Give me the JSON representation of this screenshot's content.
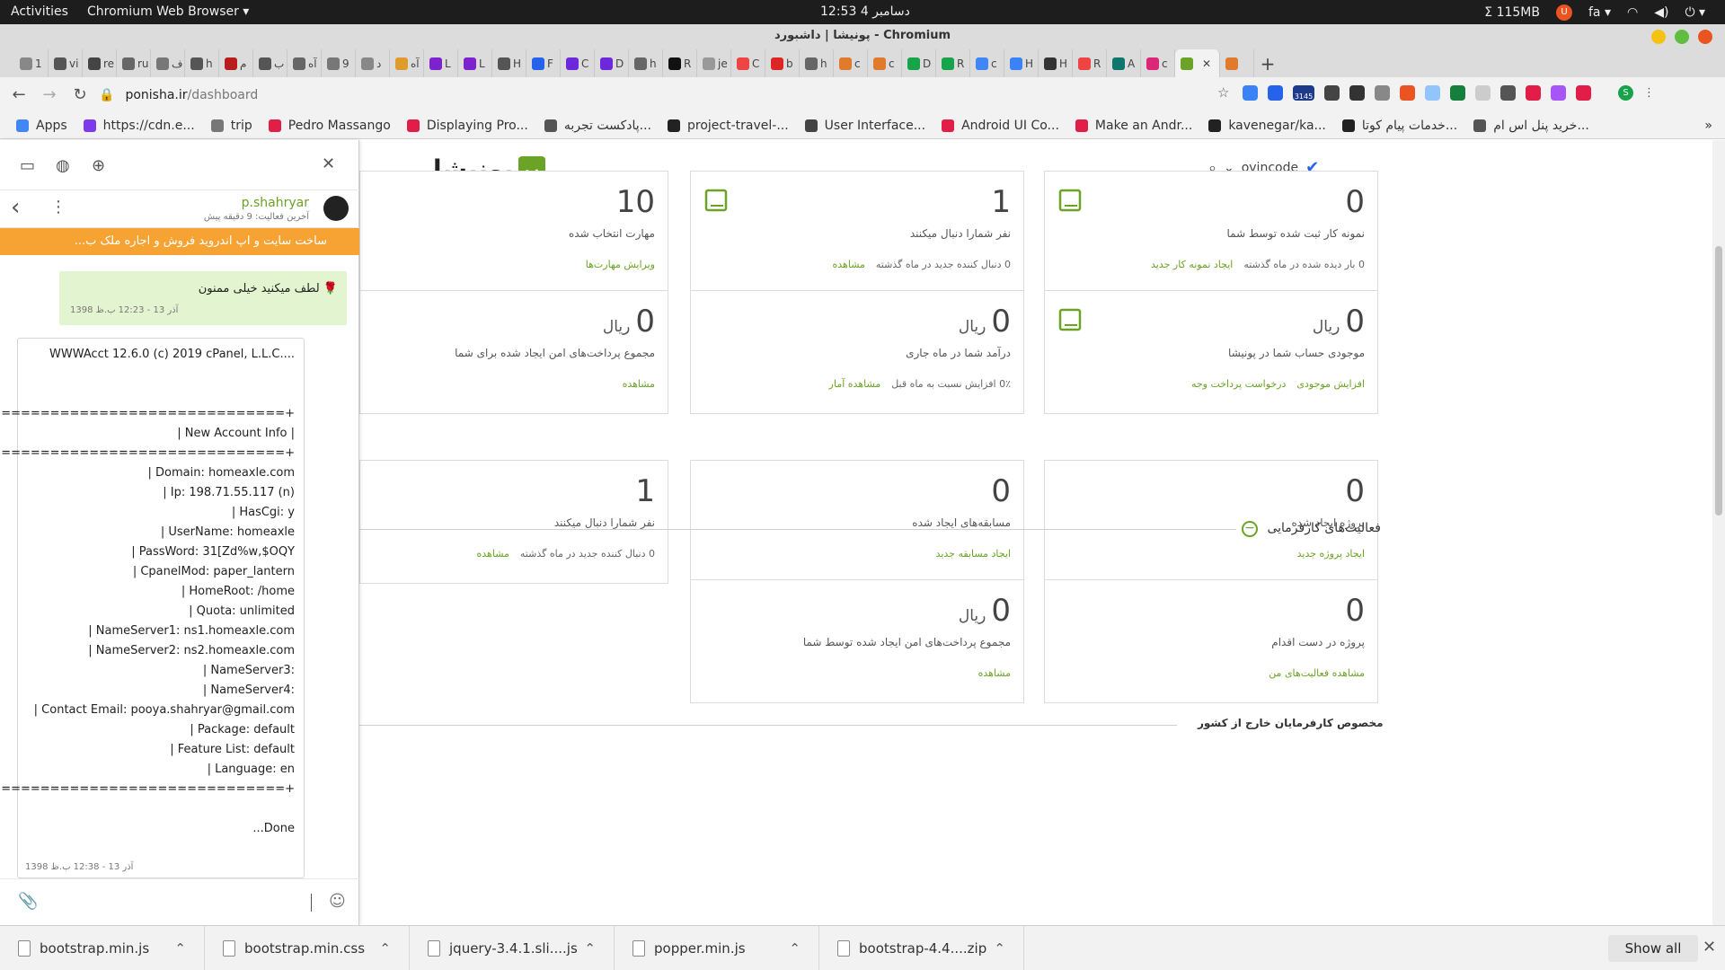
{
  "system": {
    "activities": "Activities",
    "app_menu": "Chromium Web Browser ▾",
    "clock": "دسامبر 4  12:53",
    "memory": "Σ 115MB",
    "lang": "fa ▾"
  },
  "browser": {
    "window_title": "پونیشا | داشبورد - Chromium",
    "tabs": [
      "1",
      "vi",
      "re",
      "ru",
      "ف",
      "h",
      "م",
      "ب",
      "آه",
      "9",
      "د",
      "آه",
      "L",
      "L",
      "H",
      "F",
      "C",
      "D",
      "h",
      "R",
      "je",
      "C",
      "b",
      "h",
      "c",
      "c",
      "D",
      "R",
      "c",
      "H",
      "H",
      "R",
      "A",
      "c",
      "",
      ""
    ],
    "url_host": "ponisha.ir",
    "url_path": "/dashboard",
    "bookmarks": [
      "Apps",
      "https://cdn.e...",
      "trip",
      "Pedro Massango",
      "Displaying Pro...",
      "پادکست تجربه...",
      "project-travel-...",
      "User Interface...",
      "Android UI Co...",
      "Make an Andr...",
      "kavenegar/ka...",
      "خدمات پیام کوتا...",
      "خرید پنل اس ام..."
    ],
    "ext_badge": "3145",
    "profile_initial": "S"
  },
  "site": {
    "logo_text": "پونیشا",
    "logo_mark": "پ",
    "username": "ovincode"
  },
  "freelancer_cards": [
    {
      "value": "0",
      "unit": "",
      "label": "نمونه کار ثبت شده توسط شما",
      "foot_text": "0 بار دیده شده در ماه گذشته",
      "link": "ایجاد نمونه کار جدید"
    },
    {
      "value": "1",
      "unit": "",
      "label": "نفر شمارا دنبال میکنند",
      "foot_text": "0 دنبال کننده جدید در ماه گذشته",
      "link": "مشاهده"
    },
    {
      "value": "10",
      "unit": "",
      "label": "مهارت انتخاب شده",
      "foot_text": "",
      "link": "ویرایش مهارت‌ها"
    },
    {
      "value": "0",
      "unit": "ریال",
      "label": "موجودی حساب شما در پونیشا",
      "foot_text": "",
      "link": "افزایش موجودی",
      "link2": "درخواست پرداخت وجه"
    },
    {
      "value": "0",
      "unit": "ریال",
      "label": "درآمد شما در ماه جاری",
      "foot_text": "0٪ افزایش نسبت به ماه قبل",
      "link": "مشاهده آمار"
    },
    {
      "value": "0",
      "unit": "ریال",
      "label": "مجموع پرداخت‌های امن ایجاد شده برای شما",
      "foot_text": "",
      "link": "مشاهده"
    }
  ],
  "employer_section_title": "فعالیت‌های کارفرمایی",
  "employer_cards": [
    {
      "value": "0",
      "unit": "",
      "label": "پروژه ایجاد شده",
      "foot_text": "",
      "link": "ایجاد پروژه جدید"
    },
    {
      "value": "0",
      "unit": "",
      "label": "مسابقه‌های ایجاد شده",
      "foot_text": "",
      "link": "ایجاد مسابقه جدید"
    },
    {
      "value": "1",
      "unit": "",
      "label": "نفر شمارا دنبال میکنند",
      "foot_text": "0 دنبال کننده جدید در ماه گذشته",
      "link": "مشاهده"
    },
    {
      "value": "0",
      "unit": "",
      "label": "پروژه در دست اقدام",
      "foot_text": "",
      "link": "مشاهده فعالیت‌های من"
    },
    {
      "value": "0",
      "unit": "ریال",
      "label": "مجموع پرداخت‌های امن ایجاد شده توسط شما",
      "foot_text": "",
      "link": "مشاهده"
    }
  ],
  "foreign_section_title": "مخصوص کارفرمایان خارج از کشور",
  "chat": {
    "user": "p.shahryar",
    "last_seen": "آخرین فعالیت: 9 دقیقه پیش",
    "project": "ساخت سایت و اپ اندروید فروش و اجاره ملک ب...",
    "msg1": "لطف میکنید خیلی ممنون 🌹",
    "msg1_time": "1398 آذر 13 - 12:23 ب.ظ",
    "msg2_lines": [
      "WWWAcct 12.6.0 (c) 2019 cPanel, L.L.C....",
      "+===================================+",
      "| New Account Info |",
      "+===================================+",
      "| Domain: homeaxle.com",
      "| Ip: 198.71.55.117 (n)",
      "| HasCgi: y",
      "| UserName: homeaxle",
      "| PassWord: 31[Zd%w,$OQY",
      "| CpanelMod: paper_lantern",
      "| HomeRoot: /home",
      "| Quota: unlimited",
      "| NameServer1: ns1.homeaxle.com",
      "| NameServer2: ns2.homeaxle.com",
      "| NameServer3:",
      "| NameServer4:",
      "| Contact Email: pooya.shahryar@gmail.com",
      "| Package: default",
      "| Feature List: default",
      "| Language: en",
      "+===================================+",
      "...Done"
    ],
    "msg2_time": "1398 آذر 13 - 12:38 ب.ظ"
  },
  "downloads": [
    "bootstrap.min.js",
    "bootstrap.min.css",
    "jquery-3.4.1.sli....js",
    "popper.min.js",
    "bootstrap-4.4....zip"
  ],
  "show_all": "Show all"
}
